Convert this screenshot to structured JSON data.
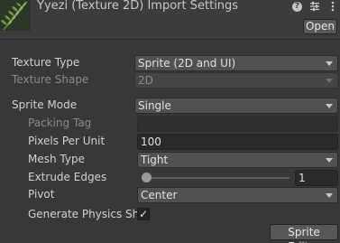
{
  "header": {
    "title": "Yyezi (Texture 2D) Import Settings",
    "open_label": "Open",
    "icons": [
      "help-icon",
      "settings-sliders-icon",
      "kebab-menu-icon"
    ],
    "help_glyph": "?"
  },
  "fields": {
    "texture_type": {
      "label": "Texture Type",
      "value": "Sprite (2D and UI)"
    },
    "texture_shape": {
      "label": "Texture Shape",
      "value": "2D"
    },
    "sprite_mode": {
      "label": "Sprite Mode",
      "value": "Single"
    },
    "packing_tag": {
      "label": "Packing Tag",
      "value": ""
    },
    "pixels_per_unit": {
      "label": "Pixels Per Unit",
      "value": "100"
    },
    "mesh_type": {
      "label": "Mesh Type",
      "value": "Tight"
    },
    "extrude_edges": {
      "label": "Extrude Edges",
      "value": "1",
      "slider_fraction": 0.03
    },
    "pivot": {
      "label": "Pivot",
      "value": "Center"
    },
    "generate_physics_shape": {
      "label": "Generate Physics Sha",
      "checked": true,
      "check_glyph": "✓"
    }
  },
  "footer": {
    "sprite_editor_label": "Sprite Editor"
  },
  "colors": {
    "background": "#383838",
    "field": "#515151",
    "text": "#d2d2d2",
    "dim_text": "#8a8a8a"
  }
}
